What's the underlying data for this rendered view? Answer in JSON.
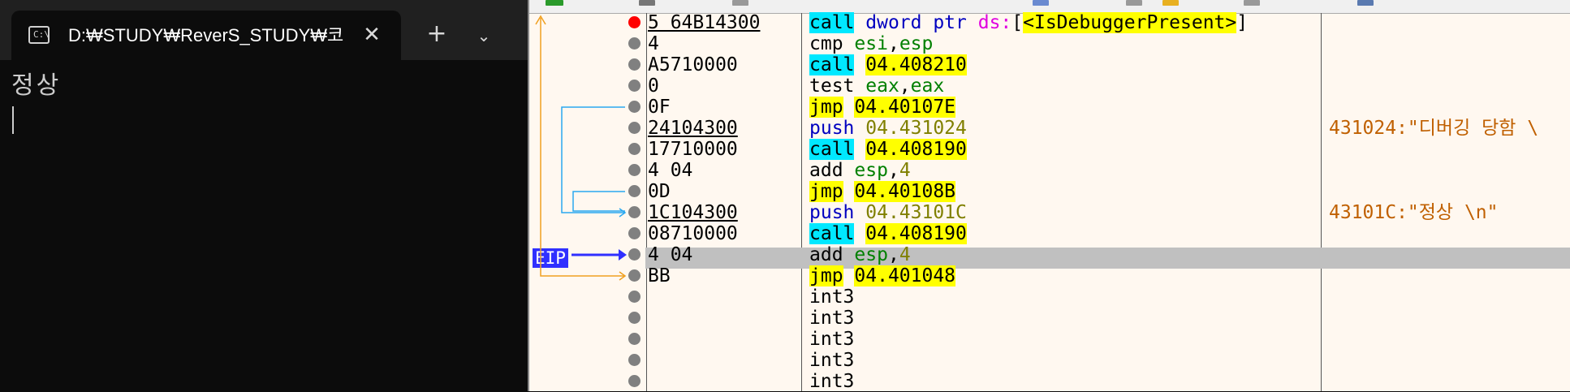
{
  "terminal": {
    "tab_title": "D:₩STUDY₩ReverS_STUDY₩코",
    "tab_icon_text": "C:\\",
    "close_glyph": "✕",
    "new_tab_glyph": "+",
    "dropdown_glyph": "⌄",
    "output_line": "정상"
  },
  "debugger": {
    "colors": {
      "call_highlight": "#00e8ff",
      "jump_highlight": "#ffff00",
      "breakpoint": "#ff0000",
      "eip_label": "#3030ff",
      "eip_row": "#c0c0c0",
      "branch_blue": "#2aa8f0",
      "branch_orange": "#f0a020"
    },
    "eip_label": "EIP",
    "rows": [
      {
        "bytes": "5 64B14300",
        "mnemonic": "call",
        "operand_a": "dword ptr",
        "operand_b": "ds:",
        "operand_c": "<IsDebuggerPresent>",
        "bracket_close": "]",
        "comment": "",
        "breakpoint": true
      },
      {
        "bytes": "4",
        "mnemonic": "cmp",
        "operand_a": "esi",
        "operand_b": "esp",
        "comment": ""
      },
      {
        "bytes": "A5710000",
        "mnemonic": "call",
        "operand_a": "04.408210",
        "comment": ""
      },
      {
        "bytes": "0",
        "mnemonic": "test",
        "operand_a": "eax",
        "operand_b": "eax",
        "comment": ""
      },
      {
        "bytes": "0F",
        "mnemonic": "jmp",
        "operand_a": "04.40107E",
        "comment": ""
      },
      {
        "bytes": "24104300",
        "mnemonic": "push",
        "operand_a": "04.431024",
        "comment": "431024:\"디버깅 당함 \\"
      },
      {
        "bytes": "17710000",
        "mnemonic": "call",
        "operand_a": "04.408190",
        "comment": ""
      },
      {
        "bytes": "4 04",
        "mnemonic": "add",
        "operand_a": "esp",
        "operand_b": "4",
        "comment": ""
      },
      {
        "bytes": "0D",
        "mnemonic": "jmp",
        "operand_a": "04.40108B",
        "comment": ""
      },
      {
        "bytes": "1C104300",
        "mnemonic": "push",
        "operand_a": "04.43101C",
        "comment": "43101C:\"정상 \\n\""
      },
      {
        "bytes": "08710000",
        "mnemonic": "call",
        "operand_a": "04.408190",
        "comment": ""
      },
      {
        "bytes": "4 04",
        "mnemonic": "add",
        "operand_a": "esp",
        "operand_b": "4",
        "comment": ""
      },
      {
        "bytes": "BB",
        "mnemonic": "jmp",
        "operand_a": "04.401048",
        "comment": ""
      },
      {
        "bytes": "",
        "mnemonic": "int3",
        "comment": ""
      },
      {
        "bytes": "",
        "mnemonic": "int3",
        "comment": ""
      },
      {
        "bytes": "",
        "mnemonic": "int3",
        "comment": ""
      },
      {
        "bytes": "",
        "mnemonic": "int3",
        "comment": ""
      },
      {
        "bytes": "",
        "mnemonic": "int3",
        "comment": ""
      }
    ]
  }
}
